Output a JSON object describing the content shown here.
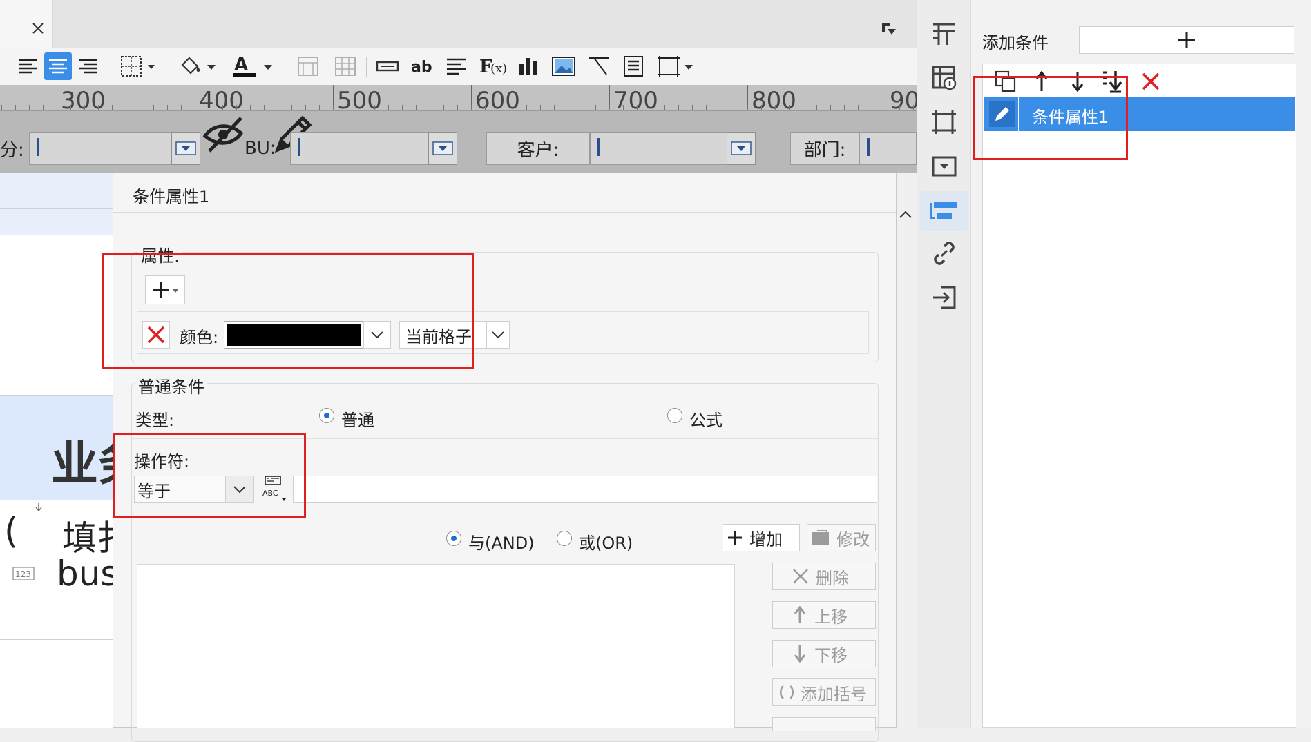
{
  "editor": {
    "ruler_ticks": [
      "300",
      "400",
      "500",
      "600",
      "700",
      "800",
      "90"
    ],
    "filters": {
      "f1_label": "分:",
      "bu_label": "BU:",
      "customer_label": "客户:",
      "dept_label": "部门:"
    },
    "sheet": {
      "cell_big": "业务",
      "cell_paren": "(",
      "cell_fill": "填扌",
      "cell_bus": "bus"
    }
  },
  "dialog": {
    "title": "条件属性1",
    "attributes_label": "属性:",
    "color_label": "颜色:",
    "color_value": "#000000",
    "scope_value": "当前格子",
    "normal_condition_label": "普通条件",
    "type_label": "类型:",
    "type_normal": "普通",
    "type_formula": "公式",
    "operator_label": "操作符:",
    "operator_value": "等于",
    "value_input": "",
    "logic_and": "与(AND)",
    "logic_or": "或(OR)",
    "add_button": "增加",
    "modify_button": "修改",
    "delete_button": "删除",
    "move_up_button": "上移",
    "move_down_button": "下移",
    "add_bracket_button": "添加括号"
  },
  "right_panel": {
    "add_condition_label": "添加条件",
    "conditions": [
      "条件属性1"
    ]
  },
  "colors": {
    "accent": "#3a8ee8",
    "red": "#e02020"
  }
}
